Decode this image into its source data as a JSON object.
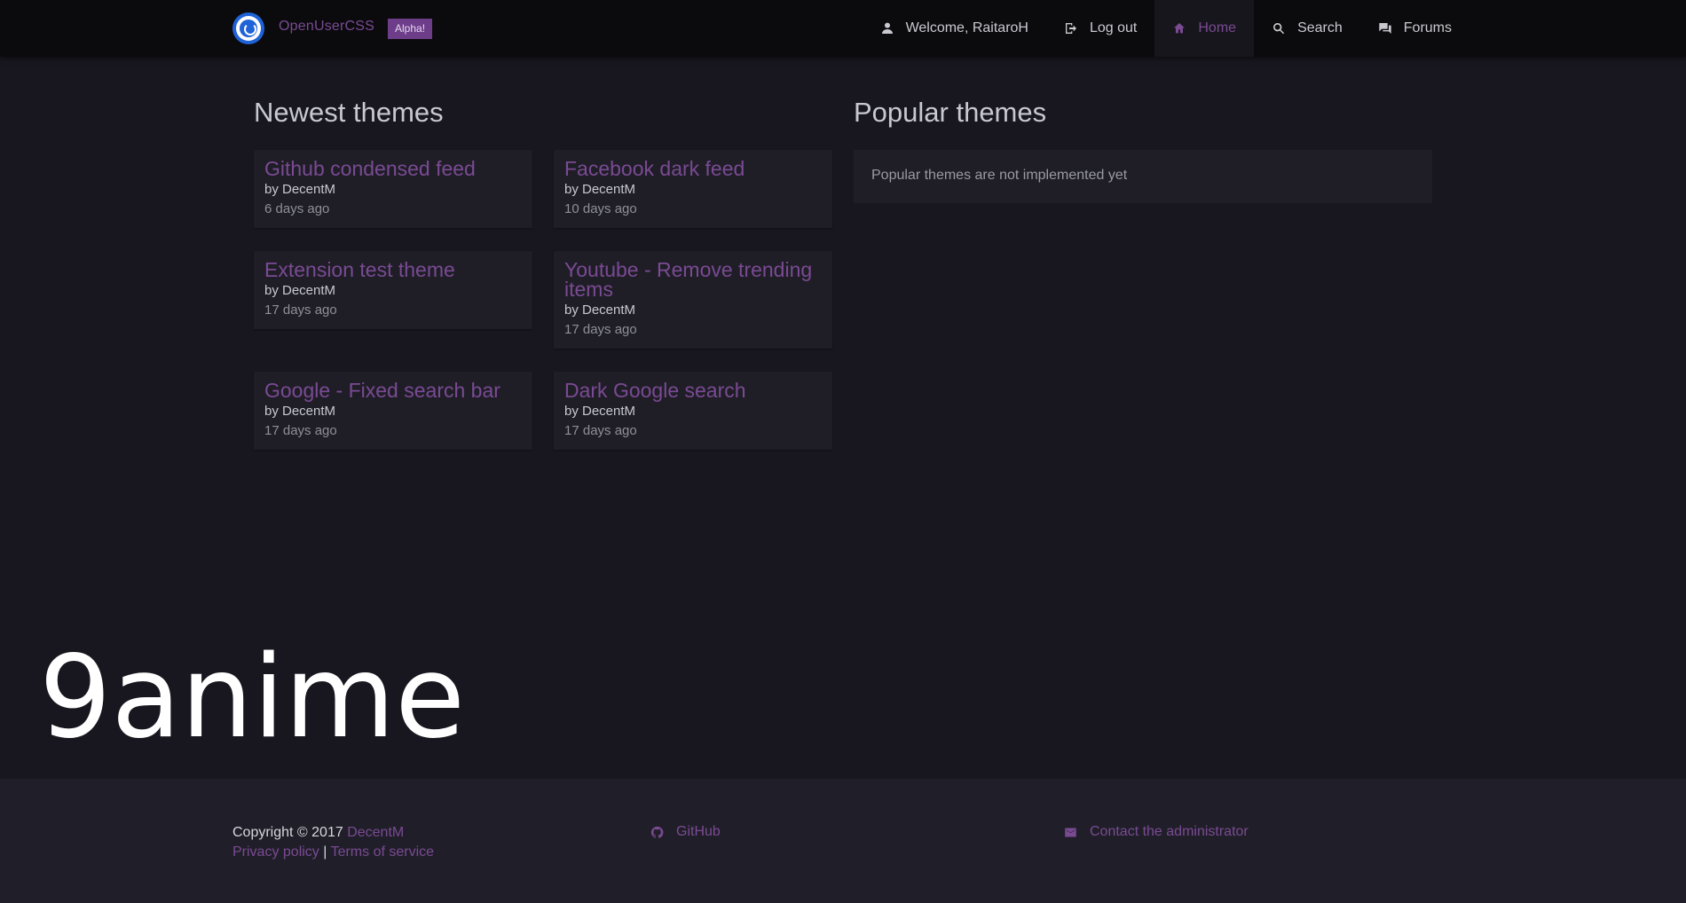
{
  "brand": {
    "name": "OpenUserCSS",
    "badge": "Alpha!"
  },
  "nav": {
    "items": [
      {
        "label": "Welcome, RaitaroH",
        "icon": "person-icon"
      },
      {
        "label": "Log out",
        "icon": "logout-icon"
      },
      {
        "label": "Home",
        "icon": "home-icon",
        "active": true
      },
      {
        "label": "Search",
        "icon": "search-icon"
      },
      {
        "label": "Forums",
        "icon": "forum-icon"
      }
    ]
  },
  "newest": {
    "title": "Newest themes",
    "themes": [
      {
        "title": "Github condensed feed",
        "author": "by DecentM",
        "time": "6 days ago"
      },
      {
        "title": "Facebook dark feed",
        "author": "by DecentM",
        "time": "10 days ago"
      },
      {
        "title": "Extension test theme",
        "author": "by DecentM",
        "time": "17 days ago"
      },
      {
        "title": "Youtube - Remove trending items",
        "author": "by DecentM",
        "time": "17 days ago"
      },
      {
        "title": "Google - Fixed search bar",
        "author": "by DecentM",
        "time": "17 days ago"
      },
      {
        "title": "Dark Google search",
        "author": "by DecentM",
        "time": "17 days ago"
      }
    ]
  },
  "popular": {
    "title": "Popular themes",
    "message": "Popular themes are not implemented yet"
  },
  "watermark": "9anime",
  "footer": {
    "copyright": "Copyright © 2017",
    "author_link": "DecentM",
    "privacy": "Privacy policy",
    "separator": "|",
    "terms": "Terms of service",
    "github": "GitHub",
    "contact": "Contact the administrator"
  },
  "colors": {
    "accent": "#7a4a93",
    "background": "#18171f",
    "navbar": "#0b0b0e",
    "card": "#1f1e27",
    "footer": "#201f29"
  }
}
